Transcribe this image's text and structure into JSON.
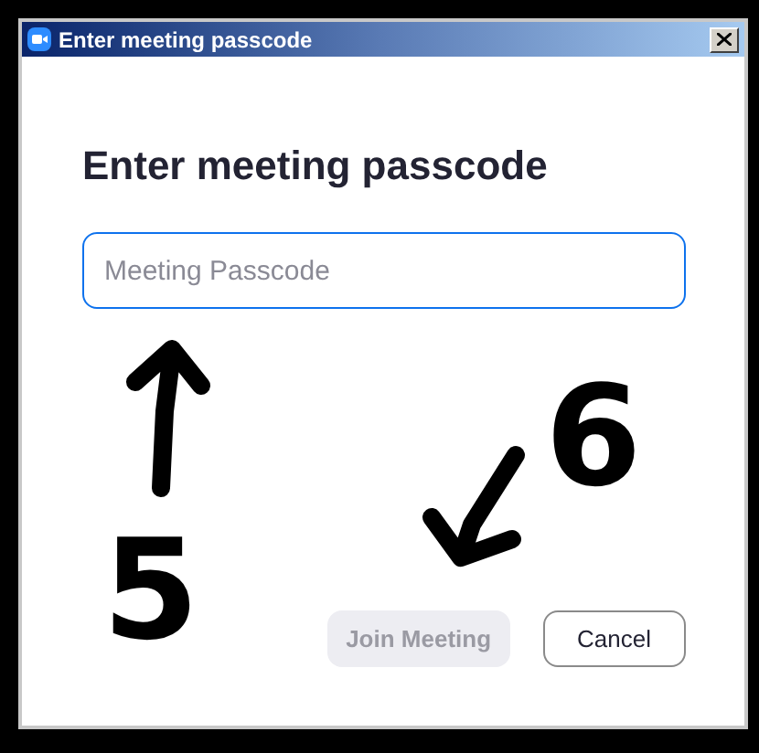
{
  "window": {
    "title": "Enter meeting passcode"
  },
  "heading": "Enter meeting passcode",
  "passcode_field": {
    "placeholder": "Meeting Passcode"
  },
  "buttons": [
    {
      "label": "Join Meeting",
      "disabled": true
    },
    {
      "label": "Cancel",
      "disabled": false
    }
  ],
  "annotations": [
    {
      "kind": "arrow-up"
    },
    {
      "kind": "number",
      "label": "5"
    },
    {
      "kind": "arrow-down-left"
    },
    {
      "kind": "number",
      "label": "6"
    }
  ]
}
